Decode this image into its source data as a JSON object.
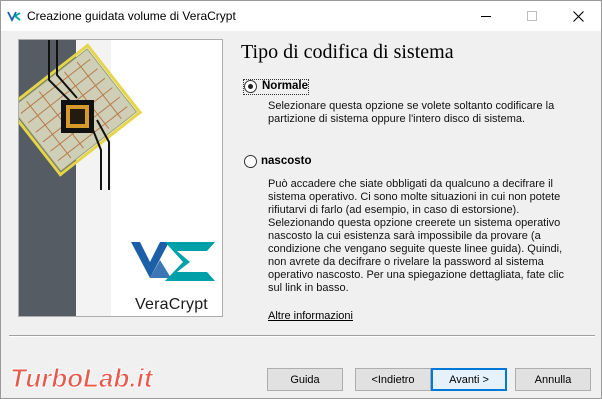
{
  "window": {
    "title": "Creazione guidata volume di VeraCrypt"
  },
  "brand": {
    "name": "VeraCrypt"
  },
  "page": {
    "title": "Tipo di codifica di sistema",
    "options": [
      {
        "label": "Normale",
        "selected": true,
        "description": "Selezionare questa opzione se volete soltanto codificare la partizione di sistema oppure l'intero disco di sistema."
      },
      {
        "label": "nascosto",
        "selected": false,
        "description": "Può accadere che siate obbligati da qualcuno a decifrare il sistema operativo. Ci sono molte situazioni in cui non potete rifiutarvi di farlo (ad esempio, in caso di estorsione). Selezionando questa opzione creerete un sistema operativo nascosto la cui esistenza sarà impossibile da provare (a condizione che vengano seguite queste linee guida). Quindi, non avrete da decifrare o rivelare la password al sistema operativo nascosto. Per una spiegazione dettagliata, fate clic sul link in basso."
      }
    ],
    "more_info_link": "Altre informazioni"
  },
  "buttons": {
    "help": "Guida",
    "back": "<Indietro",
    "next": "Avanti >",
    "cancel": "Annulla"
  },
  "watermark": {
    "text": "TurboLab.it"
  },
  "colors": {
    "accent": "#0078d7",
    "logo_teal": "#00a0a8",
    "logo_blue": "#1a5fa8",
    "watermark": "#e8483a"
  },
  "icons": [
    "veracrypt-app-icon",
    "minimize-icon",
    "maximize-icon",
    "close-icon",
    "veracrypt-chip-logo"
  ]
}
